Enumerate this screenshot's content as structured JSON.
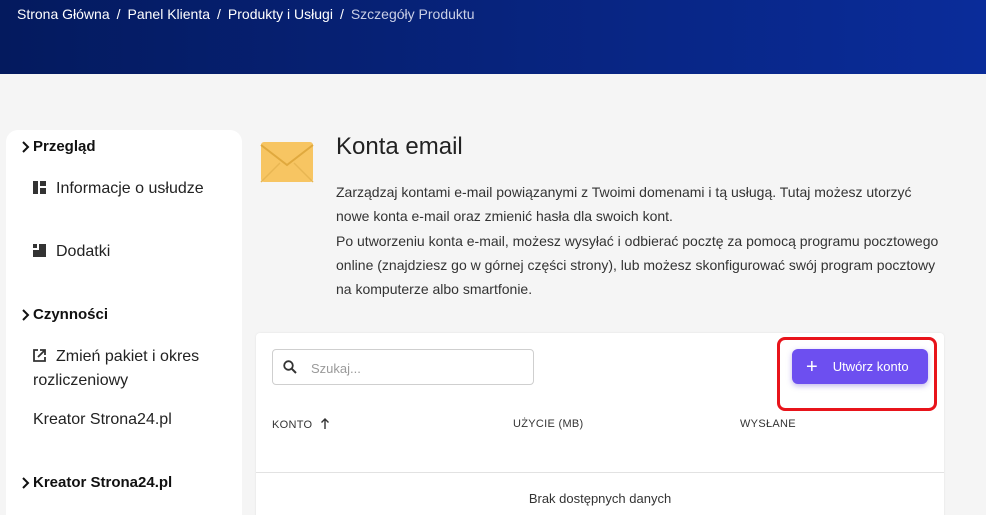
{
  "breadcrumb": [
    {
      "label": "Strona Główna"
    },
    {
      "label": "Panel Klienta"
    },
    {
      "label": "Produkty i Usługi"
    },
    {
      "label": "Szczegóły Produktu"
    }
  ],
  "breadcrumb_separator": "/",
  "sidebar": {
    "sections": [
      {
        "title": "Przegląd",
        "items": [
          {
            "label": "Informacje o usłudze",
            "icon": "info-grid-icon"
          },
          {
            "label": "Dodatki",
            "icon": "addons-icon"
          }
        ]
      },
      {
        "title": "Czynności",
        "items": [
          {
            "label": "Zmień pakiet i okres rozliczeniowy",
            "icon": "external-link-icon"
          },
          {
            "label": "Kreator Strona24.pl"
          }
        ]
      },
      {
        "title": "Kreator Strona24.pl",
        "items": []
      }
    ]
  },
  "main": {
    "icon": "envelope-icon",
    "title": "Konta email",
    "description": [
      "Zarządzaj kontami e-mail powiązanymi z Twoimi domenami i tą usługą. Tutaj możesz utorzyć nowe konta e-mail oraz zmienić hasła dla swoich kont.",
      "Po utworzeniu konta e-mail, możesz wysyłać i odbierać pocztę za pomocą programu pocztowego online (znajdziesz go w górnej części strony), lub możesz skonfigurować swój program pocztowy na komputerze albo smartfonie."
    ]
  },
  "table": {
    "search_placeholder": "Szukaj...",
    "search_value": "",
    "create_button_label": "Utwórz konto",
    "columns": [
      "KONTO",
      "UŻYCIE (MB)",
      "WYSŁANE"
    ],
    "sort_column": "KONTO",
    "sort_direction": "ascending",
    "empty_text": "Brak dostępnych danych"
  },
  "colors": {
    "header_gradient_start": "#041a5e",
    "header_gradient_end": "#0a2c9a",
    "accent": "#6d4ff0",
    "highlight": "#e8141b",
    "envelope": "#f7c562"
  }
}
